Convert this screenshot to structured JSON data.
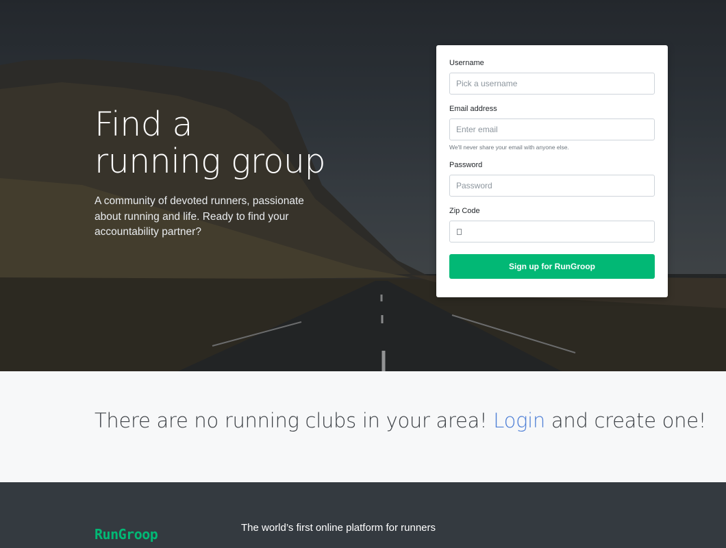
{
  "hero": {
    "title": "Find a running group",
    "lead": "A community of devoted runners, passionate about running and life. Ready to find your accountability partner?"
  },
  "signup_form": {
    "username_label": "Username",
    "username_placeholder": "Pick a username",
    "username_value": "",
    "email_label": "Email address",
    "email_placeholder": "Enter email",
    "email_value": "",
    "email_help": "We'll never share your email with anyone else.",
    "password_label": "Password",
    "password_placeholder": "Password",
    "password_value": "",
    "zip_label": "Zip Code",
    "zip_value": "",
    "submit_label": "Sign up for RunGroop"
  },
  "empty_state": {
    "text_before": "There are no running clubs in your area! ",
    "login_link": "Login",
    "text_after": " and create one!"
  },
  "footer": {
    "brand": "RunGroop",
    "tagline": "The world’s first online platform for runners"
  },
  "colors": {
    "accent": "#02b875",
    "link": "#4e7fd6",
    "footer_bg": "#343a40",
    "section_bg": "#f7f8f9"
  }
}
